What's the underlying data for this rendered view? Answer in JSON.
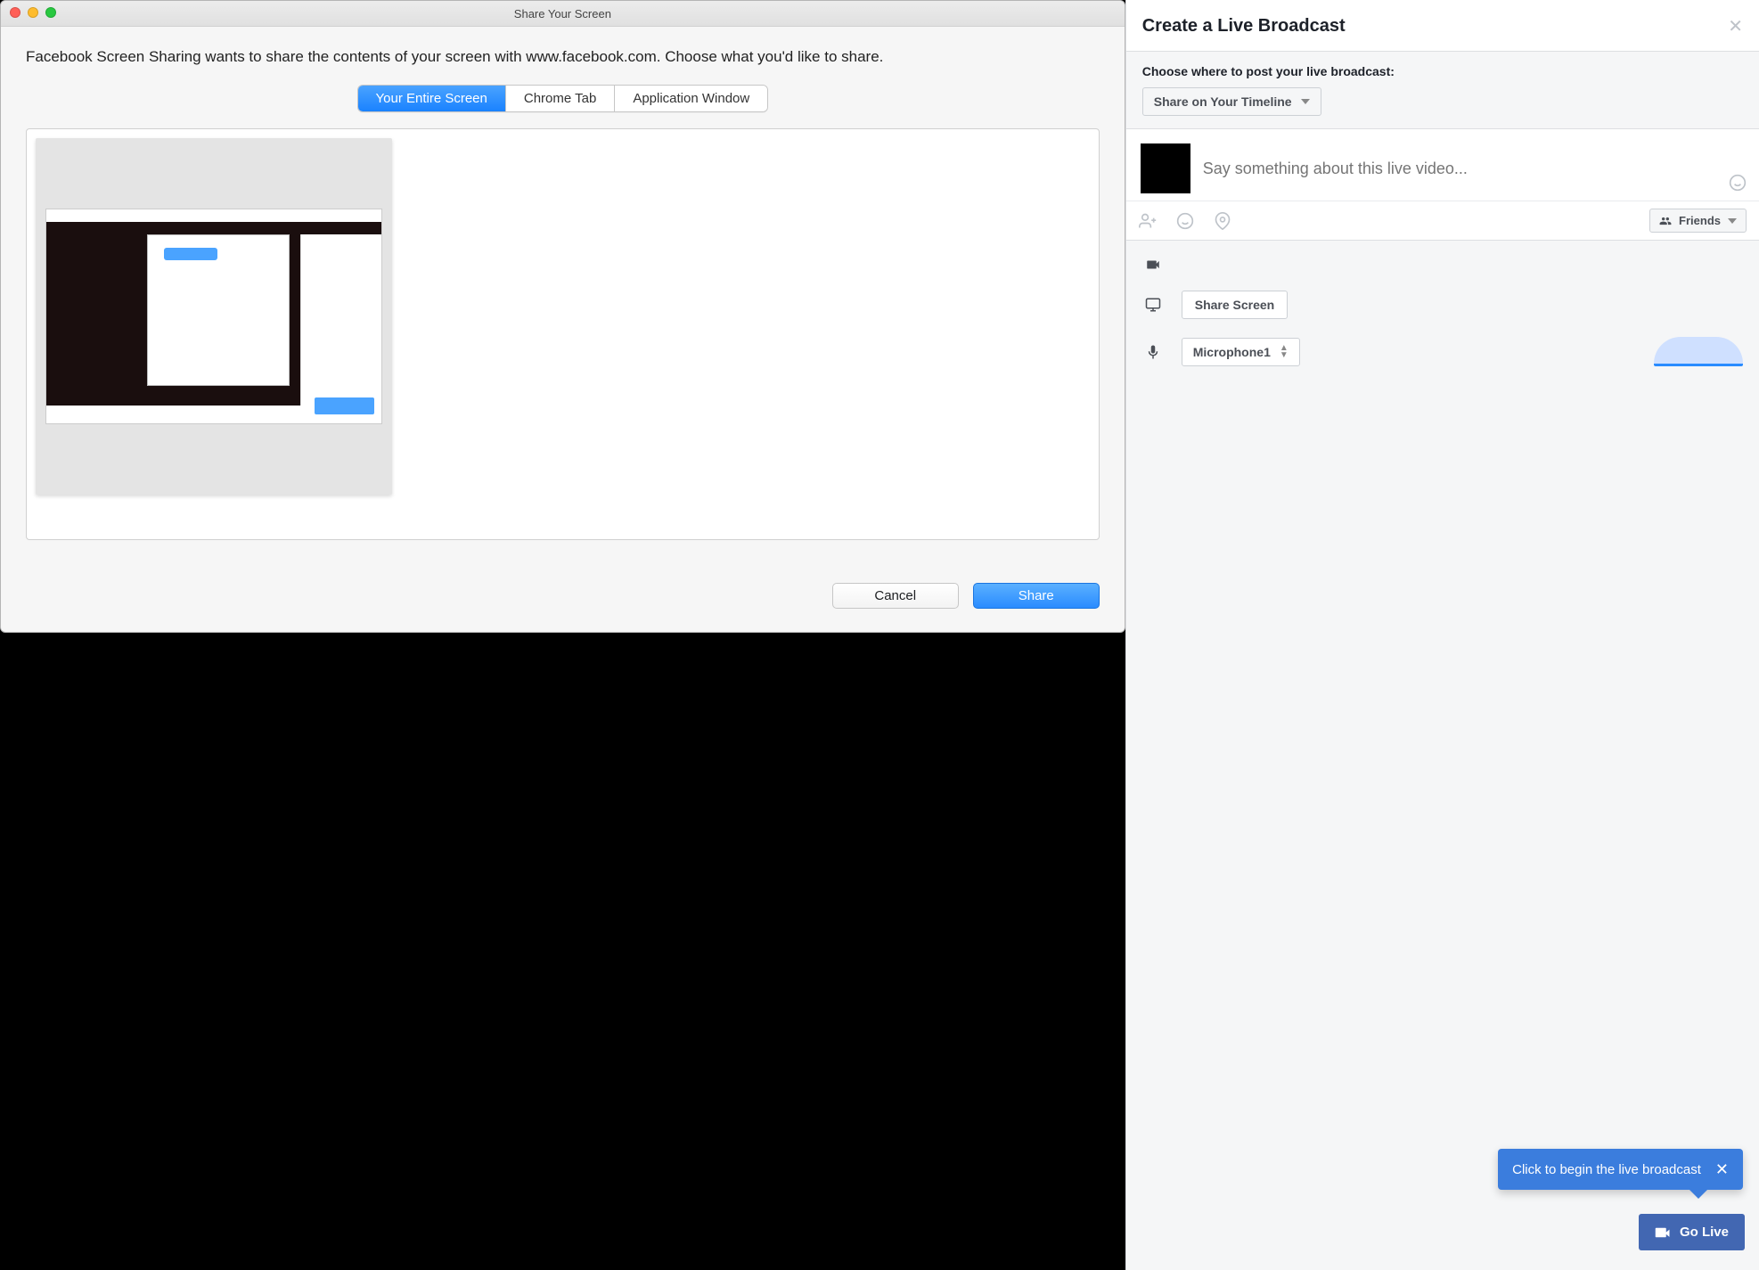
{
  "dialog": {
    "title": "Share Your Screen",
    "prompt": "Facebook Screen Sharing wants to share the contents of your screen with www.facebook.com. Choose what you'd like to share.",
    "tabs": [
      "Your Entire Screen",
      "Chrome Tab",
      "Application Window"
    ],
    "active_tab_index": 0,
    "cancel": "Cancel",
    "share": "Share"
  },
  "broadcast": {
    "title": "Create a Live Broadcast",
    "choose_label": "Choose where to post your live broadcast:",
    "post_to": "Share on Your Timeline",
    "placeholder": "Say something about this live video...",
    "audience": "Friends",
    "share_screen": "Share Screen",
    "microphone": "Microphone1",
    "tooltip": "Click to begin the live broadcast",
    "go_live": "Go Live"
  }
}
